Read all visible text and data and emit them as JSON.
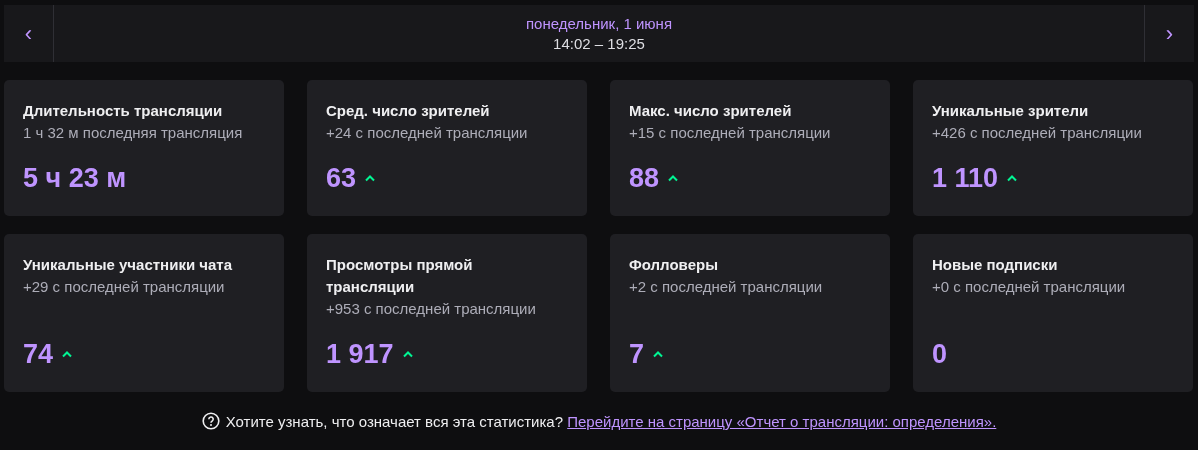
{
  "header": {
    "prev_label": "‹",
    "date": "понедельник, 1 июня",
    "time_range": "14:02 – 19:25",
    "next_label": "›"
  },
  "stats": [
    {
      "title": "Длительность трансляции",
      "subtitle": "1 ч 32 м последняя трансляция",
      "value": "5 ч 23 м",
      "rising": false
    },
    {
      "title": "Сред. число зрителей",
      "subtitle": "+24 с последней трансляции",
      "value": "63",
      "rising": true
    },
    {
      "title": "Макс. число зрителей",
      "subtitle": "+15 с последней трансляции",
      "value": "88",
      "rising": true
    },
    {
      "title": "Уникальные зрители",
      "subtitle": "+426 с последней трансляции",
      "value": "1 110",
      "rising": true
    },
    {
      "title": "Уникальные участники чата",
      "subtitle": "+29 с последней трансляции",
      "value": "74",
      "rising": true
    },
    {
      "title": "Просмотры прямой трансляции",
      "subtitle": "+953 с последней трансляции",
      "value": "1 917",
      "rising": true
    },
    {
      "title": "Фолловеры",
      "subtitle": "+2 с последней трансляции",
      "value": "7",
      "rising": true
    },
    {
      "title": "Новые подписки",
      "subtitle": "+0 с последней трансляции",
      "value": "0",
      "rising": false
    }
  ],
  "footer": {
    "question": "Хотите узнать, что означает вся эта статистика?",
    "link": "Перейдите на страницу «Отчет о трансляции: определения»."
  }
}
